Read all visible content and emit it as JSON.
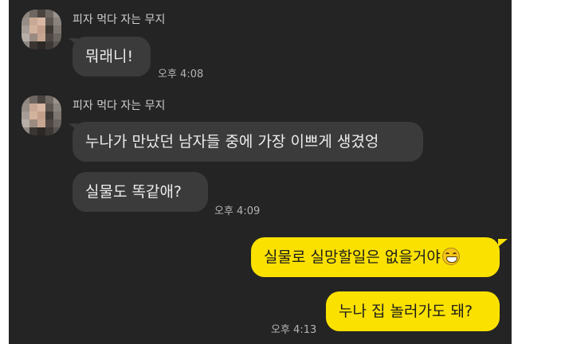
{
  "chat": {
    "sender_name": "피자 먹다 자는 무지",
    "messages": [
      {
        "text": "뭐래니!",
        "time": "오후 4:08"
      },
      {
        "text": "누나가 만났던 남자들 중에 가장 이쁘게 생겼엉"
      },
      {
        "text": "실물도 똑같애?",
        "time": "오후 4:09"
      },
      {
        "text": "실물로 실망할일은 없을거야",
        "emoji": "grinning-face-emoji"
      },
      {
        "text": "누나 집 놀러가도 돼?",
        "time": "오후 4:13"
      }
    ]
  },
  "colors": {
    "background": "#242424",
    "received_bubble": "#3b3b3b",
    "sent_bubble": "#fae100",
    "received_text": "#ececec",
    "sent_text": "#1d1d1d",
    "meta_text": "#b4b4b4"
  }
}
